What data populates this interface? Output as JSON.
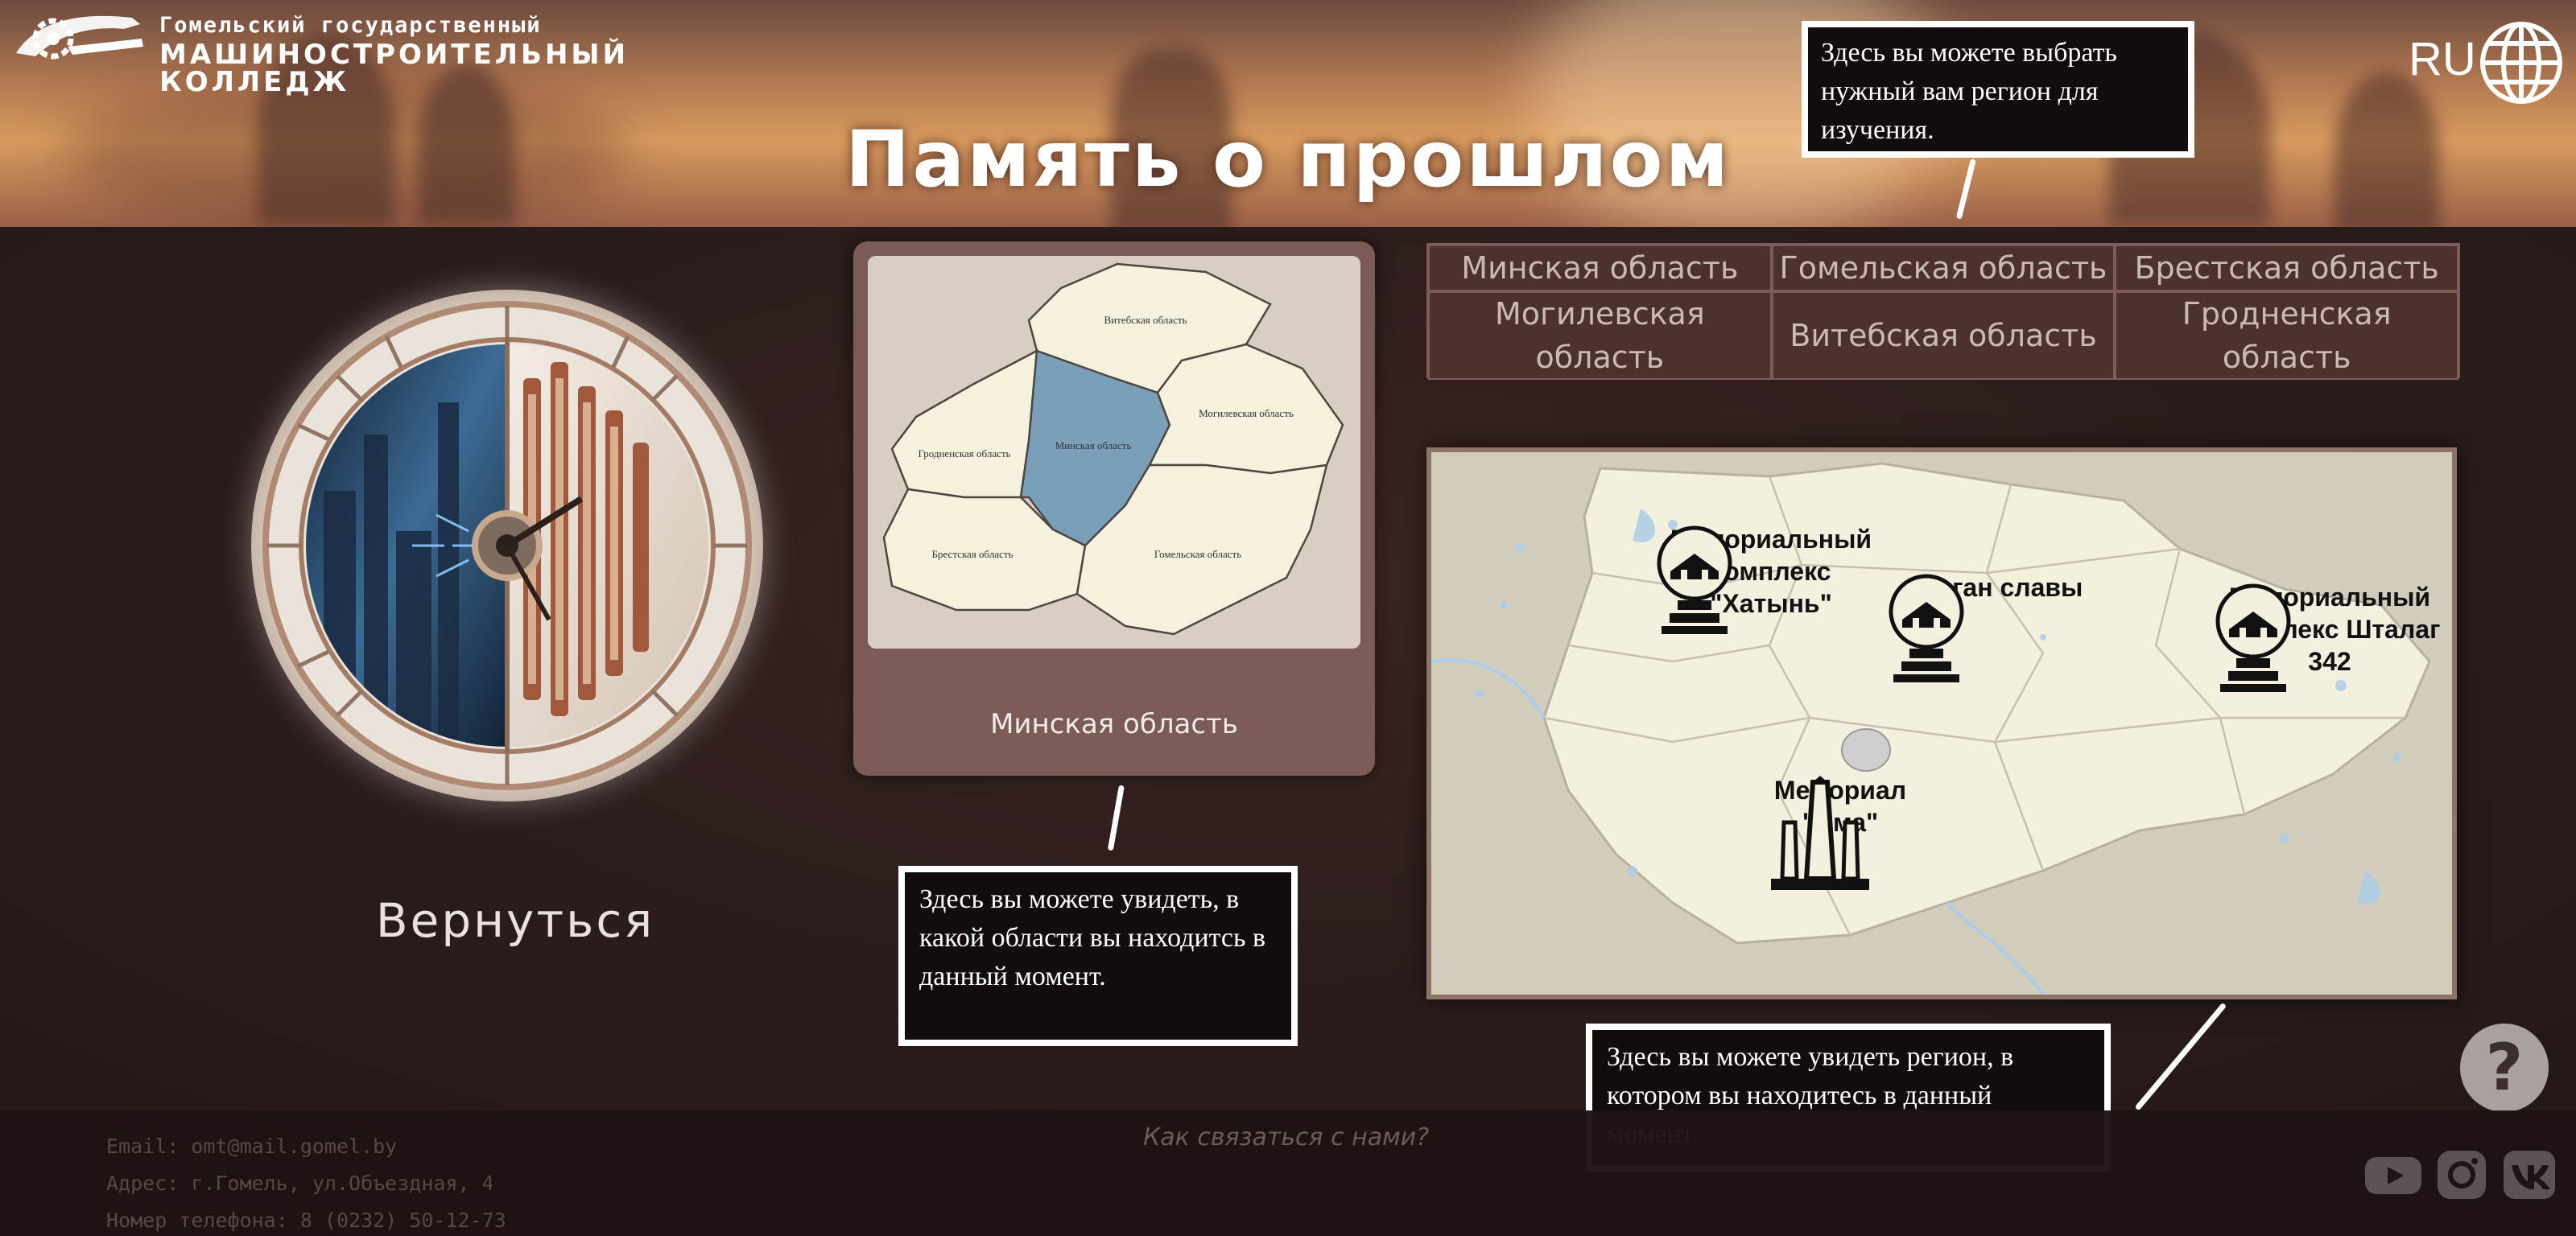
{
  "header": {
    "logo": {
      "line1": "Гомельский государственный",
      "line2": "МАШИНОСТРОИТЕЛЬНЫЙ КОЛЛЕДЖ"
    },
    "title": "Память о прошлом",
    "language": {
      "code": "RU",
      "icon": "globe-icon"
    }
  },
  "tips": {
    "regions": "Здесь вы можете выбрать нужный вам регион для изучения.",
    "current": "Здесь вы можете увидеть, в какой области вы находитсь в данный момент.",
    "map": "Здесь вы можете увидеть регион, в котором вы находитесь в данный момент."
  },
  "back": {
    "label": "Вернуться"
  },
  "current_region": {
    "label": "Минская область",
    "map_labels": {
      "vitebsk": "Витебская область",
      "grodno": "Гродненская область",
      "minsk": "Минская область",
      "mogilev": "Могилевская область",
      "brest": "Брестская область",
      "gomel": "Гомельская область"
    }
  },
  "regions": [
    {
      "label": "Минская область"
    },
    {
      "label": "Гомельская область"
    },
    {
      "label": "Брестская область"
    },
    {
      "label": "Могилевская область"
    },
    {
      "label": "Витебская область"
    },
    {
      "label": "Гродненская область"
    }
  ],
  "memorials": [
    {
      "label": "Мемориальный комплекс \"Хатынь\"",
      "icon": "memorial-icon"
    },
    {
      "label": "Курган славы",
      "icon": "memorial-icon"
    },
    {
      "label": "Мемориальный комплекс Шталаг 342",
      "icon": "memorial-icon"
    },
    {
      "label": "Мемориал \"Яма\"",
      "icon": "obelisk-icon"
    }
  ],
  "help": {
    "label": "?"
  },
  "footer": {
    "email": "Email: omt@mail.gomel.by",
    "address": "Адрес: г.Гомель, ул.Объездная, 4",
    "phone": "Номер телефона: 8 (0232) 50-12-73",
    "contact_link": "Как связаться с нами?",
    "social": [
      "youtube-icon",
      "instagram-icon",
      "vk-icon"
    ]
  },
  "colors": {
    "background": "#2a1b1a",
    "panel": "#4c312d",
    "highlight_region": "#7b9fb9",
    "map_land": "#f3f0df"
  }
}
